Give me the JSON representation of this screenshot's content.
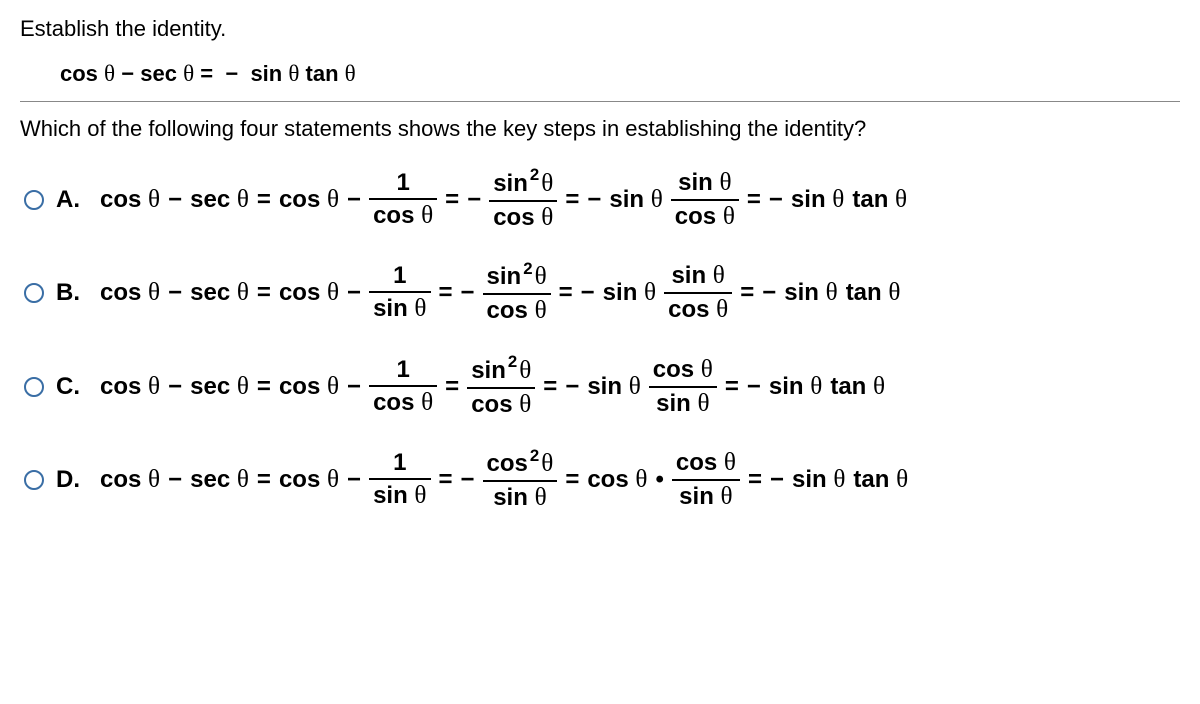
{
  "prompt": "Establish the identity.",
  "identity_html": "cos θ − sec θ = − sin θ tan θ",
  "question": "Which of the following four statements shows the key steps in establishing the identity?",
  "theta": "θ",
  "labels": {
    "A": "A.",
    "B": "B.",
    "C": "C.",
    "D": "D."
  },
  "txt": {
    "cos": "cos",
    "sec": "sec",
    "sin": "sin",
    "tan": "tan",
    "one": "1",
    "two": "2",
    "minus": "−",
    "eq": "=",
    "dot": "•"
  },
  "chart_data": {
    "type": "table",
    "title": "Multiple choice derivations for cosθ − secθ = −sinθ tanθ",
    "options": [
      {
        "label": "A",
        "steps": [
          "cos θ − sec θ = cos θ − 1/cos θ",
          "= − sin²θ / cos θ",
          "= − sin θ · (sin θ / cos θ)",
          "= − sin θ tan θ"
        ]
      },
      {
        "label": "B",
        "steps": [
          "cos θ − sec θ = cos θ − 1/sin θ",
          "= − sin²θ / cos θ",
          "= − sin θ · (sin θ / cos θ)",
          "= − sin θ tan θ"
        ]
      },
      {
        "label": "C",
        "steps": [
          "cos θ − sec θ = cos θ − 1/cos θ",
          "= sin²θ / cos θ",
          "= − sin θ · (cos θ / sin θ)",
          "= − sin θ tan θ"
        ]
      },
      {
        "label": "D",
        "steps": [
          "cos θ − sec θ = cos θ − 1/sin θ",
          "= − cos²θ / sin θ",
          "= cos θ · (cos θ / sin θ)",
          "= − sin θ tan θ"
        ]
      }
    ]
  }
}
